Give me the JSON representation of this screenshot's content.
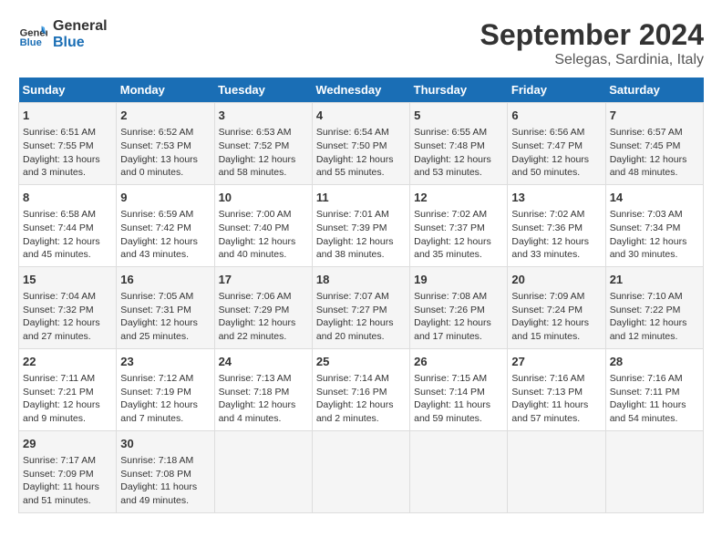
{
  "header": {
    "logo_general": "General",
    "logo_blue": "Blue",
    "month": "September 2024",
    "location": "Selegas, Sardinia, Italy"
  },
  "days_of_week": [
    "Sunday",
    "Monday",
    "Tuesday",
    "Wednesday",
    "Thursday",
    "Friday",
    "Saturday"
  ],
  "weeks": [
    [
      {
        "day": 1,
        "data": "Sunrise: 6:51 AM\nSunset: 7:55 PM\nDaylight: 13 hours\nand 3 minutes."
      },
      {
        "day": 2,
        "data": "Sunrise: 6:52 AM\nSunset: 7:53 PM\nDaylight: 13 hours\nand 0 minutes."
      },
      {
        "day": 3,
        "data": "Sunrise: 6:53 AM\nSunset: 7:52 PM\nDaylight: 12 hours\nand 58 minutes."
      },
      {
        "day": 4,
        "data": "Sunrise: 6:54 AM\nSunset: 7:50 PM\nDaylight: 12 hours\nand 55 minutes."
      },
      {
        "day": 5,
        "data": "Sunrise: 6:55 AM\nSunset: 7:48 PM\nDaylight: 12 hours\nand 53 minutes."
      },
      {
        "day": 6,
        "data": "Sunrise: 6:56 AM\nSunset: 7:47 PM\nDaylight: 12 hours\nand 50 minutes."
      },
      {
        "day": 7,
        "data": "Sunrise: 6:57 AM\nSunset: 7:45 PM\nDaylight: 12 hours\nand 48 minutes."
      }
    ],
    [
      {
        "day": 8,
        "data": "Sunrise: 6:58 AM\nSunset: 7:44 PM\nDaylight: 12 hours\nand 45 minutes."
      },
      {
        "day": 9,
        "data": "Sunrise: 6:59 AM\nSunset: 7:42 PM\nDaylight: 12 hours\nand 43 minutes."
      },
      {
        "day": 10,
        "data": "Sunrise: 7:00 AM\nSunset: 7:40 PM\nDaylight: 12 hours\nand 40 minutes."
      },
      {
        "day": 11,
        "data": "Sunrise: 7:01 AM\nSunset: 7:39 PM\nDaylight: 12 hours\nand 38 minutes."
      },
      {
        "day": 12,
        "data": "Sunrise: 7:02 AM\nSunset: 7:37 PM\nDaylight: 12 hours\nand 35 minutes."
      },
      {
        "day": 13,
        "data": "Sunrise: 7:02 AM\nSunset: 7:36 PM\nDaylight: 12 hours\nand 33 minutes."
      },
      {
        "day": 14,
        "data": "Sunrise: 7:03 AM\nSunset: 7:34 PM\nDaylight: 12 hours\nand 30 minutes."
      }
    ],
    [
      {
        "day": 15,
        "data": "Sunrise: 7:04 AM\nSunset: 7:32 PM\nDaylight: 12 hours\nand 27 minutes."
      },
      {
        "day": 16,
        "data": "Sunrise: 7:05 AM\nSunset: 7:31 PM\nDaylight: 12 hours\nand 25 minutes."
      },
      {
        "day": 17,
        "data": "Sunrise: 7:06 AM\nSunset: 7:29 PM\nDaylight: 12 hours\nand 22 minutes."
      },
      {
        "day": 18,
        "data": "Sunrise: 7:07 AM\nSunset: 7:27 PM\nDaylight: 12 hours\nand 20 minutes."
      },
      {
        "day": 19,
        "data": "Sunrise: 7:08 AM\nSunset: 7:26 PM\nDaylight: 12 hours\nand 17 minutes."
      },
      {
        "day": 20,
        "data": "Sunrise: 7:09 AM\nSunset: 7:24 PM\nDaylight: 12 hours\nand 15 minutes."
      },
      {
        "day": 21,
        "data": "Sunrise: 7:10 AM\nSunset: 7:22 PM\nDaylight: 12 hours\nand 12 minutes."
      }
    ],
    [
      {
        "day": 22,
        "data": "Sunrise: 7:11 AM\nSunset: 7:21 PM\nDaylight: 12 hours\nand 9 minutes."
      },
      {
        "day": 23,
        "data": "Sunrise: 7:12 AM\nSunset: 7:19 PM\nDaylight: 12 hours\nand 7 minutes."
      },
      {
        "day": 24,
        "data": "Sunrise: 7:13 AM\nSunset: 7:18 PM\nDaylight: 12 hours\nand 4 minutes."
      },
      {
        "day": 25,
        "data": "Sunrise: 7:14 AM\nSunset: 7:16 PM\nDaylight: 12 hours\nand 2 minutes."
      },
      {
        "day": 26,
        "data": "Sunrise: 7:15 AM\nSunset: 7:14 PM\nDaylight: 11 hours\nand 59 minutes."
      },
      {
        "day": 27,
        "data": "Sunrise: 7:16 AM\nSunset: 7:13 PM\nDaylight: 11 hours\nand 57 minutes."
      },
      {
        "day": 28,
        "data": "Sunrise: 7:16 AM\nSunset: 7:11 PM\nDaylight: 11 hours\nand 54 minutes."
      }
    ],
    [
      {
        "day": 29,
        "data": "Sunrise: 7:17 AM\nSunset: 7:09 PM\nDaylight: 11 hours\nand 51 minutes."
      },
      {
        "day": 30,
        "data": "Sunrise: 7:18 AM\nSunset: 7:08 PM\nDaylight: 11 hours\nand 49 minutes."
      },
      null,
      null,
      null,
      null,
      null
    ]
  ]
}
